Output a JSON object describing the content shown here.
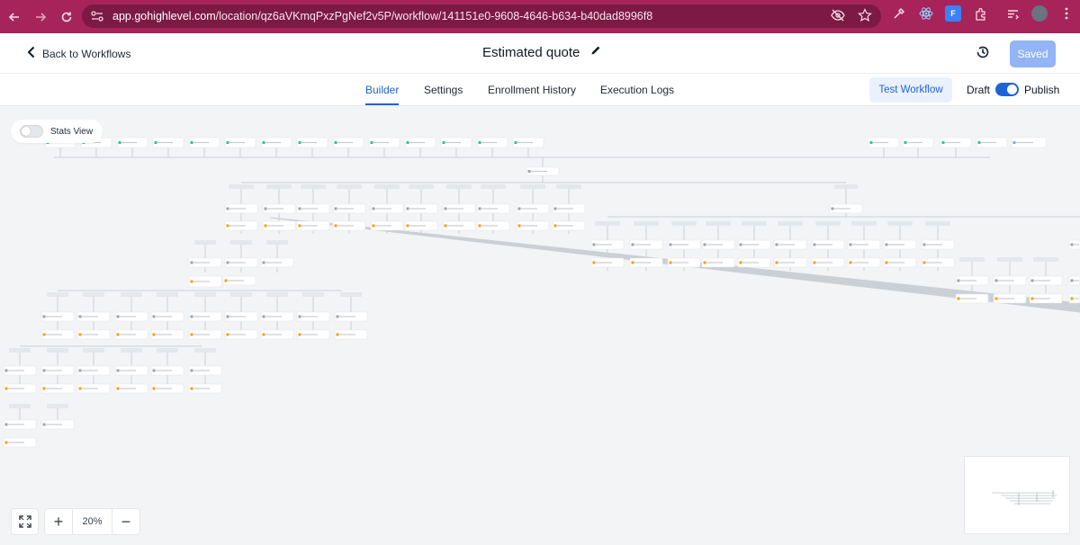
{
  "browser": {
    "url_host": "app.gohighlevel.com",
    "url_path": "/location/qz6aVKmqPxzPgNef2v5P/workflow/141151e0-9608-4646-b634-b40dad8996f8"
  },
  "header": {
    "back_label": "Back to Workflows",
    "title": "Estimated quote",
    "saved_label": "Saved"
  },
  "tabs": [
    {
      "label": "Builder",
      "active": true
    },
    {
      "label": "Settings",
      "active": false
    },
    {
      "label": "Enrollment History",
      "active": false
    },
    {
      "label": "Execution Logs",
      "active": false
    }
  ],
  "actions": {
    "test_label": "Test Workflow",
    "draft_label": "Draft",
    "publish_label": "Publish",
    "publish_on": true
  },
  "canvas": {
    "stats_label": "Stats View",
    "stats_on": false,
    "zoom": "20%",
    "zoom_in": "+",
    "zoom_out": "−"
  },
  "colors": {
    "chrome": "#a6245a",
    "accent": "#1d63d8",
    "saved_bg": "#93b4f5"
  }
}
